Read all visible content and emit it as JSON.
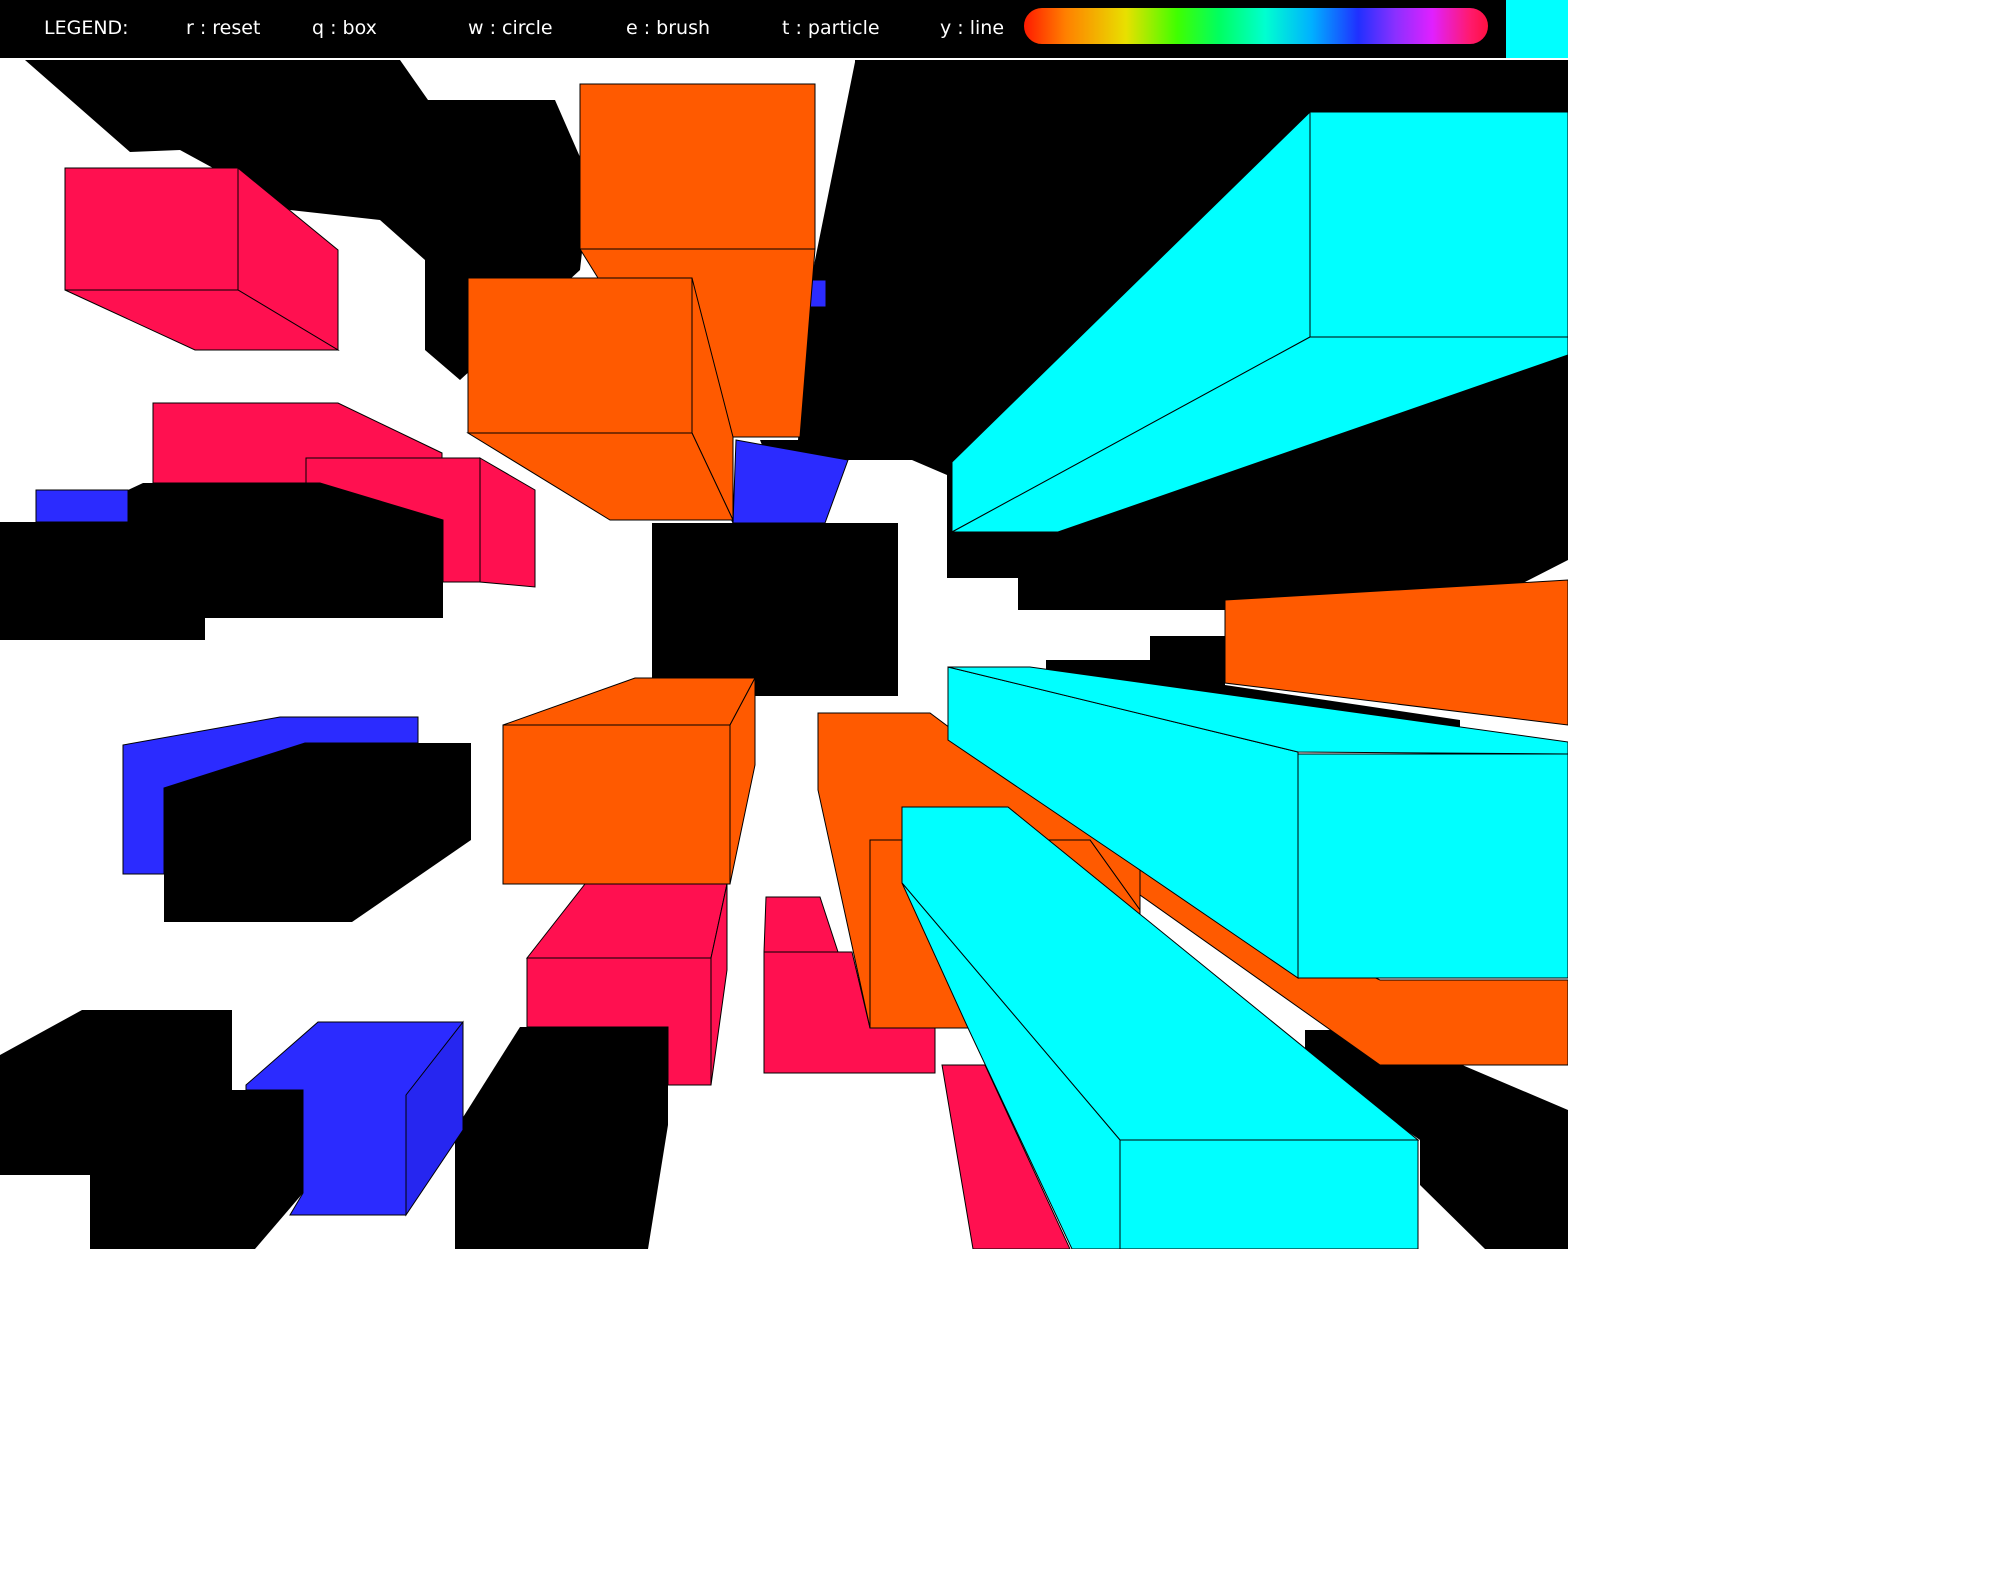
{
  "legend": {
    "title": "LEGEND:",
    "items": [
      {
        "label": "r : reset"
      },
      {
        "label": "q : box"
      },
      {
        "label": "w : circle"
      },
      {
        "label": "e : brush"
      },
      {
        "label": "t : particle"
      },
      {
        "label": "y : line"
      }
    ]
  },
  "selected_color": "#00ffff",
  "palette": {
    "cyan": "#00ffff",
    "orange": "#ff5a00",
    "red": "#ff1050",
    "blue": "#2b2bff",
    "shadow": "#000000",
    "toolbar": "#000000"
  },
  "scene": {
    "object_count": 22,
    "tool_in_use": "box"
  }
}
